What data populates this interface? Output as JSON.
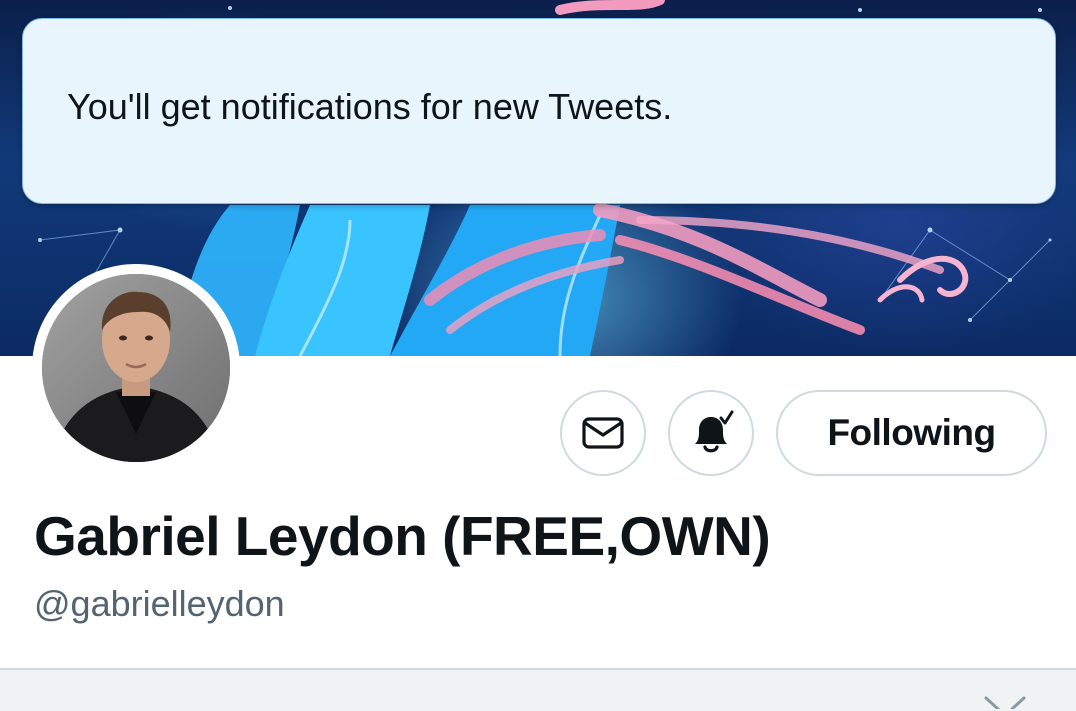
{
  "toast": {
    "message": "You'll get notifications for new Tweets."
  },
  "profile": {
    "display_name": "Gabriel Leydon (FREE,OWN)",
    "handle": "@gabrielleydon"
  },
  "actions": {
    "message_icon": "envelope-icon",
    "notify_icon": "bell-check-icon",
    "follow_label": "Following"
  },
  "colors": {
    "toast_bg": "#e8f5fd",
    "toast_border": "#7fbde6",
    "text_primary": "#0f1419",
    "text_secondary": "#536471",
    "button_border": "#cfd9de",
    "bottom_bg": "#eff3f4"
  }
}
